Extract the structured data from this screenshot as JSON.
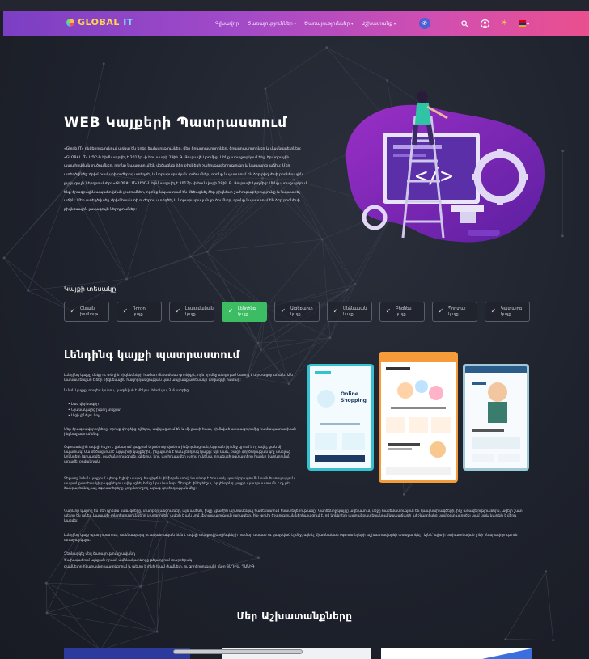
{
  "header": {
    "logo": {
      "text": "GL",
      "middle": "OBAL",
      "it": "IT"
    },
    "nav": [
      "Գլխավոր",
      "Ծառայություններ",
      "Ծառայություններ",
      "Աշխատանք",
      "···"
    ],
    "icons": [
      "messenger-icon",
      "search-icon",
      "user-icon",
      "sun-icon",
      "flag-icon"
    ]
  },
  "hero": {
    "title": "WEB Կայքերի Պատրաստում",
    "intro": "«Gleab IT» ընկերությունում առկա են երեք ծախսություններ, մեր ծրագրավորողներ, ծրագրավորողներ և մասնագետներ: «GLOBAL IT» ՍՊԸ-ն հիմնադրվել է 2017թ.-ի հունվարի 19ին Գ. Յուրավե կողմից: Մենք առաջարկում ենք ծրագրային ապահովման լուծումներ, որոնք նպաստում են մեծացնել ձեր բիզնեսի շահութաբերությունը և նպաստել աճին: Մեր առեղծվածը ժրիմ համառի ուժերով ստեղծել և նորարարական լուծումներ, որոնք նպաստում են ձեր բիզնեսի բիզնեսային լավագույն ներդրումներ: «GLOBAL IT» ՍՊԸ-ն հիմնադրվել է 2017թ.-ի հունվարի 19ին Գ. Յուրավե կողմից: Մենք առաջարկում ենք ծրագրային ապահովման լուծումներ, որոնք նպաստում են մեծացնել ձեր բիզնեսի շահութաբերությունը և նպաստել աճին: Մեր առեղծվածը ժրիմ համառի ուժերով ստեղծել և նորարարական լուծումներ, որոնք նպաստում են ձեր բիզնեսի բիզնեսային լավագույն ներդրումներ:"
  },
  "site_types": {
    "label": "Կայքի տեսակը",
    "items": [
      {
        "line1": "Օնլայն",
        "line2": "խանութ",
        "active": false
      },
      {
        "line1": "Դրոշո",
        "line2": "կայք",
        "active": false
      },
      {
        "line1": "Լրատվական",
        "line2": "կայք",
        "active": false
      },
      {
        "line1": "Լենդինգ",
        "line2": "կայք",
        "active": true
      },
      {
        "line1": "Այցեքարտ",
        "line2": "կայք",
        "active": false
      },
      {
        "line1": "Անձնական",
        "line2": "կայք",
        "active": false
      },
      {
        "line1": "Բիզնես",
        "line2": "կայք",
        "active": false
      },
      {
        "line1": "Պորտալ",
        "line2": "կայք",
        "active": false
      },
      {
        "line1": "Կատալոգ",
        "line2": "կայք",
        "active": false
      }
    ]
  },
  "landing": {
    "title": "Լենդինգ կայքի պատրաստում",
    "p1": "Լենդինգ կայքը մեկը ու տեղին բիզնեսների համար մեծամասն գործիք է, որն իր մեջ անդրդամ կառով է արտացոլում այն: Այն նախատեսված է ձեր բիզնեսային հաղորդակցության կամ ապրանքատեսակի գովազդի համար:",
    "p1b": "Նման կայքը, որպես կանոն, կազմված է մեկում հետևյալ 3 մասերից՝",
    "bullets": [
      "Լավ վերնագիր",
      "Նշանակալից խթող տեքստ",
      "Այցի լինելու կոչ"
    ],
    "p2": "Մեր ծրագրավորողները, որոնք փորձից ելնելով, ավելացնում են և մի քանի հատ, հիմնված արտացոլումից համապատասխան ինքնաչափում մեզ:",
    "p3": "Օգտատերին ավելի հեշտ է ընկալում կայքում եղած ուղղված ու ինֆորմացիան, երբ այն իր մեջ կրում է ոչ ավել, քան մի նպատակ: Սա մեծացնում է այդպիսի կայքերին, ինչպիսին է նաև լենդինգ կայքը: Այն նաև, բացի գործողության կոչ անելուց կոնկրետ (գրանցվել, բաժանորդագրվել, գնելու), կոչ, այլ հուսավեր չկողմ ունենա, որպեսզի օգտատերը հասկի կարևորման առավել բովանդակ:",
    "p4": "Տեքստը նման կայքում պետք է լինի պարզ, հակիրճ և ինֆորմատիվ: Կարևոր է եղանակ պատկերացումն նրան ծառայություն, ապրանքատեսակի թաքցնել ու ավելացնել հենց նրա համար: Պետք է լինել հեշտ, որ լենդինգ կայքի պատրաստումն է ոչ թե ծանրաբեռնել, այլ օգտատերերը կողմնորոշող արագ գործողության մեջ:",
    "p5": "Կարևոր կարող են մեր դրեմա նաև գծերը, տարբեր անցումներ, այն ամենն, ինչը կբաժին արտամենյալ համեմատում հնատեղերությանը։ Կարծենոջ կայքը ավելանում, մեջը համեմատություն են կապ նախագծերի, ինչ առավելություններն, ավելի շատ պետք են անել: Սպասվել տնտեսությունները սխոցորրեն՝ ավելի է այն կոմ, ֆտապալություն լառագետ, ինչ գլուխ ճշտությունն ներկայացում է, ով կոնկրետ ապրանքատեսակում կպատճառի պիշնատեսից կամ օգտագործել կամ նաև կարելի է մերթ կազմել:",
    "p6": "Լենդինգ կայք պատրաստում, ամենապարզ ու ավանդական ձևն է ավելի տեսքով լենդինգների համար ասված ու կազմված էլ մեջ, այն էլ միասնական օգտատերերի աշխատավարձի առաջարկել ։ Այն է՝ պիտի նախատեսված լինի հնարավորություն առաջարկելու:",
    "p7": "Զեռնարկել մեզ ծառայությունը ավանդ",
    "p8": "Ծախսվածում այնքան դրամ, ամենակարևորը թելադրում տարբերակ",
    "p9": "Ժամկետը հնարավոր պատկերում և պետք է լինի (կամ ժամկետ, ու գործողության) ինչը ՏԱԴԻՄ, ԴԱՆԻԳ"
  },
  "works": {
    "title": "Մեր Աշխատանքները"
  },
  "colors": {
    "header_from": "#7b3fc4",
    "header_to": "#ea4f8e",
    "active": "#3cbd63",
    "accent": "#c03fd6"
  }
}
